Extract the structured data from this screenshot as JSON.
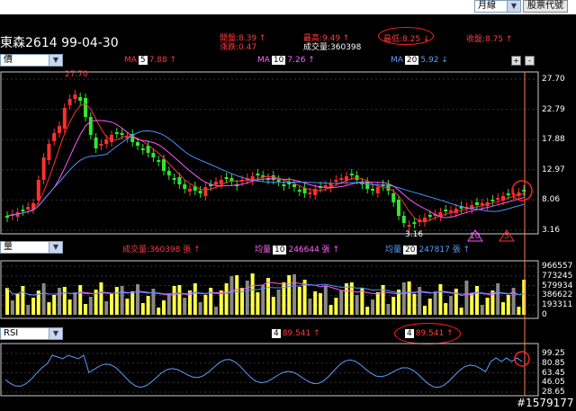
{
  "toolbar": {
    "period_value": "月線",
    "stock_code_label": "股票代號"
  },
  "header": {
    "stock_title": "東森2614 99-04-30",
    "open_text": "開盤:8.39 ↑",
    "change_text": "漲跌:0.47",
    "high_text": "最高:9.49 ↑",
    "volume_text": "成交量:360398",
    "low_text": "最低:8.25 ↓",
    "close_text": "收盤:8.75 ↑"
  },
  "price_panel": {
    "selector_value": "價",
    "ma5_label": "MA",
    "ma5_box": "5",
    "ma5_value": "7.88 ↑",
    "ma10_label": "MA",
    "ma10_box": "10",
    "ma10_value": "7.26 ↑",
    "ma20_label": "MA",
    "ma20_box": "20",
    "ma20_value": "5.92 ↓",
    "zoom_in": "+",
    "zoom_out": "-",
    "peak_label": "27.70",
    "trough_label": "3.16",
    "marker_10": "10",
    "marker_5": "5",
    "y_ticks": [
      "27.70",
      "22.79",
      "17.88",
      "12.97",
      "8.06",
      "3.16"
    ]
  },
  "volume_panel": {
    "selector_value": "量",
    "vol_text": "成交量:360398 張 ↑",
    "avg10_label": "均量",
    "avg10_box": "10",
    "avg10_value": "246644 張 ↑",
    "avg20_label": "均量",
    "avg20_box": "20",
    "avg20_value": "247817 張 ↑",
    "y_ticks": [
      "966557",
      "773245",
      "579934",
      "386622",
      "193311",
      "0"
    ]
  },
  "rsi_panel": {
    "selector_value": "RSI",
    "rsi_box1": "4",
    "rsi_value1": "89.541 ↑",
    "rsi_box2": "4",
    "rsi_value2": "89.541 ↑",
    "y_ticks": [
      "99.25",
      "80.85",
      "63.45",
      "46.05",
      "28.65"
    ],
    "watermark": "#1579177"
  },
  "colors": {
    "up": "#ff3030",
    "down": "#2ee82e",
    "ma5": "#ff3030",
    "ma10": "#ff55ff",
    "ma20": "#4a90ff",
    "vol_up": "#ffff44",
    "vol_down": "#888888"
  }
}
